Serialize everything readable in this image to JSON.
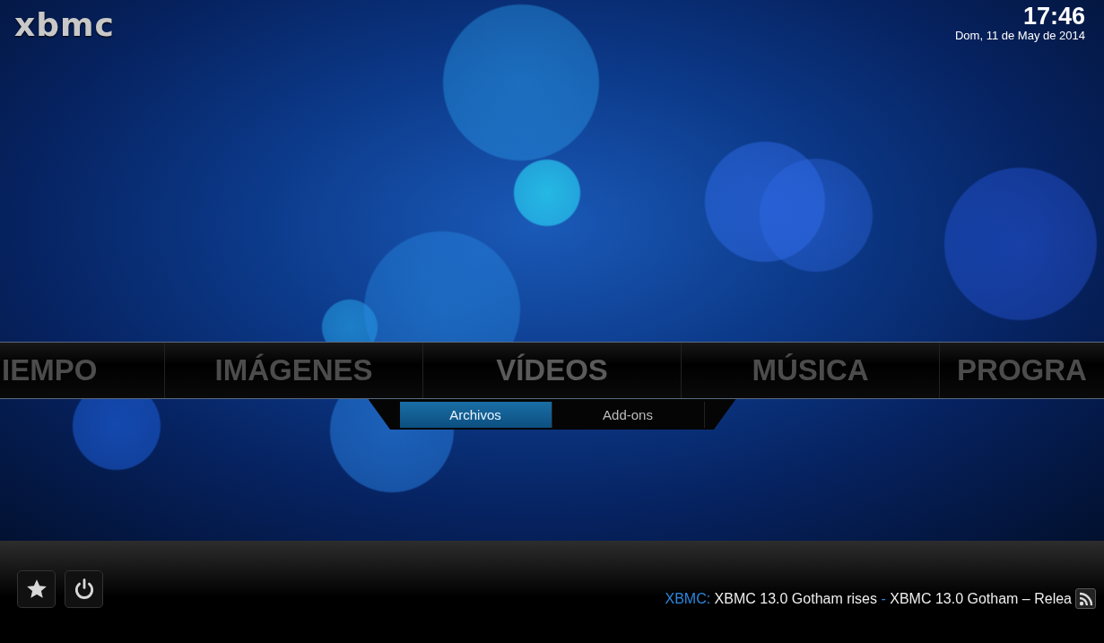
{
  "logo": "xbmc",
  "clock": {
    "time": "17:46",
    "date": "Dom, 11 de May de 2014"
  },
  "main_menu": [
    {
      "label": "IEMPO",
      "selected": false
    },
    {
      "label": "IMÁGENES",
      "selected": false
    },
    {
      "label": "VÍDEOS",
      "selected": true
    },
    {
      "label": "MÚSICA",
      "selected": false
    },
    {
      "label": "PROGRA",
      "selected": false
    }
  ],
  "submenu": [
    {
      "label": "Archivos",
      "selected": true
    },
    {
      "label": "Add-ons",
      "selected": false
    }
  ],
  "bottom_buttons": [
    {
      "kind": "favourites"
    },
    {
      "kind": "power"
    }
  ],
  "ticker": {
    "source": "XBMC:",
    "separator": "-",
    "items": [
      "XBMC 13.0 Gotham rises",
      "XBMC 13.0 Gotham – Relea"
    ]
  }
}
